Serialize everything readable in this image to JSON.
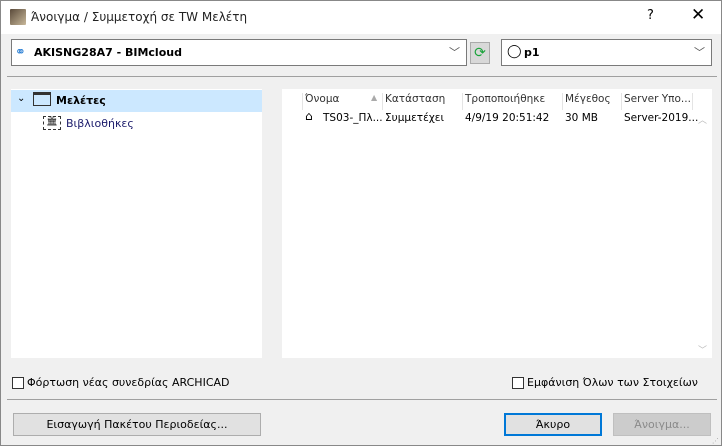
{
  "window": {
    "title": "Άνοιγμα / Συμμετοχή σε TW Μελέτη",
    "help_label": "?",
    "close_label": "✕"
  },
  "server": {
    "value": "AKISNG28A7 - BIMcloud",
    "icon": "server-network-icon"
  },
  "refresh": {
    "icon": "refresh-icon",
    "glyph": "⟳"
  },
  "user": {
    "value": "p1",
    "icon": "user-icon"
  },
  "tree": {
    "items": [
      {
        "label": "Μελέτες",
        "selected": true,
        "expanded": true
      },
      {
        "label": "Βιβλιοθήκες"
      }
    ]
  },
  "list": {
    "columns": [
      "Όνομα",
      "Κατάσταση",
      "Τροποποιήθηκε",
      "Μέγεθος",
      "Server Υπο..."
    ],
    "sorted_column": "Όνομα",
    "rows": [
      {
        "name": "TS03-_Πλ...",
        "status": "Συμμετέχει",
        "modified": "4/9/19 20:51:42",
        "size": "30 MB",
        "server": "Server-2019..."
      }
    ]
  },
  "options": {
    "load_new_session": "Φόρτωση νέας συνεδρίας ARCHICAD",
    "show_all": "Εμφάνιση Όλων των Στοιχείων"
  },
  "buttons": {
    "import": "Εισαγωγή Πακέτου Περιοδείας...",
    "cancel": "Άκυρο",
    "open": "Άνοιγμα..."
  }
}
